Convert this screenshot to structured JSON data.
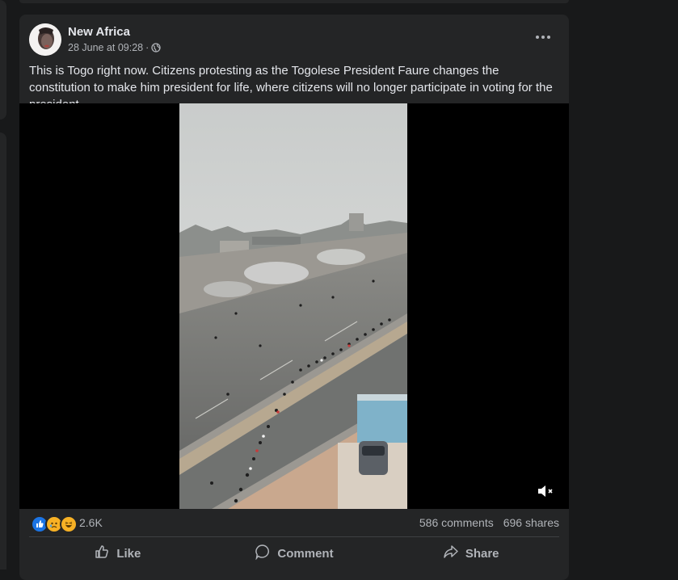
{
  "post": {
    "author": "New Africa",
    "timestamp": "28 June at 09:28",
    "separator": "·",
    "privacy_icon": "globe-icon",
    "more_icon": "more-options-icon",
    "caption": "This is Togo right now. Citizens protesting as the Togolese President Faure changes the constitution to make him president for life, where citizens will no longer participate in voting for the president."
  },
  "video": {
    "mute_icon": "speaker-muted-icon"
  },
  "reactions": {
    "icons": [
      "like-reaction-icon",
      "sad-reaction-icon",
      "haha-reaction-icon"
    ],
    "count": "2.6K",
    "comments": "586 comments",
    "shares": "696 shares"
  },
  "actions": {
    "like": "Like",
    "comment": "Comment",
    "share": "Share"
  },
  "colors": {
    "background": "#18191a",
    "card": "#242526",
    "text_primary": "#e4e6eb",
    "text_secondary": "#b0b3b8",
    "like_blue": "#1b74e4"
  }
}
